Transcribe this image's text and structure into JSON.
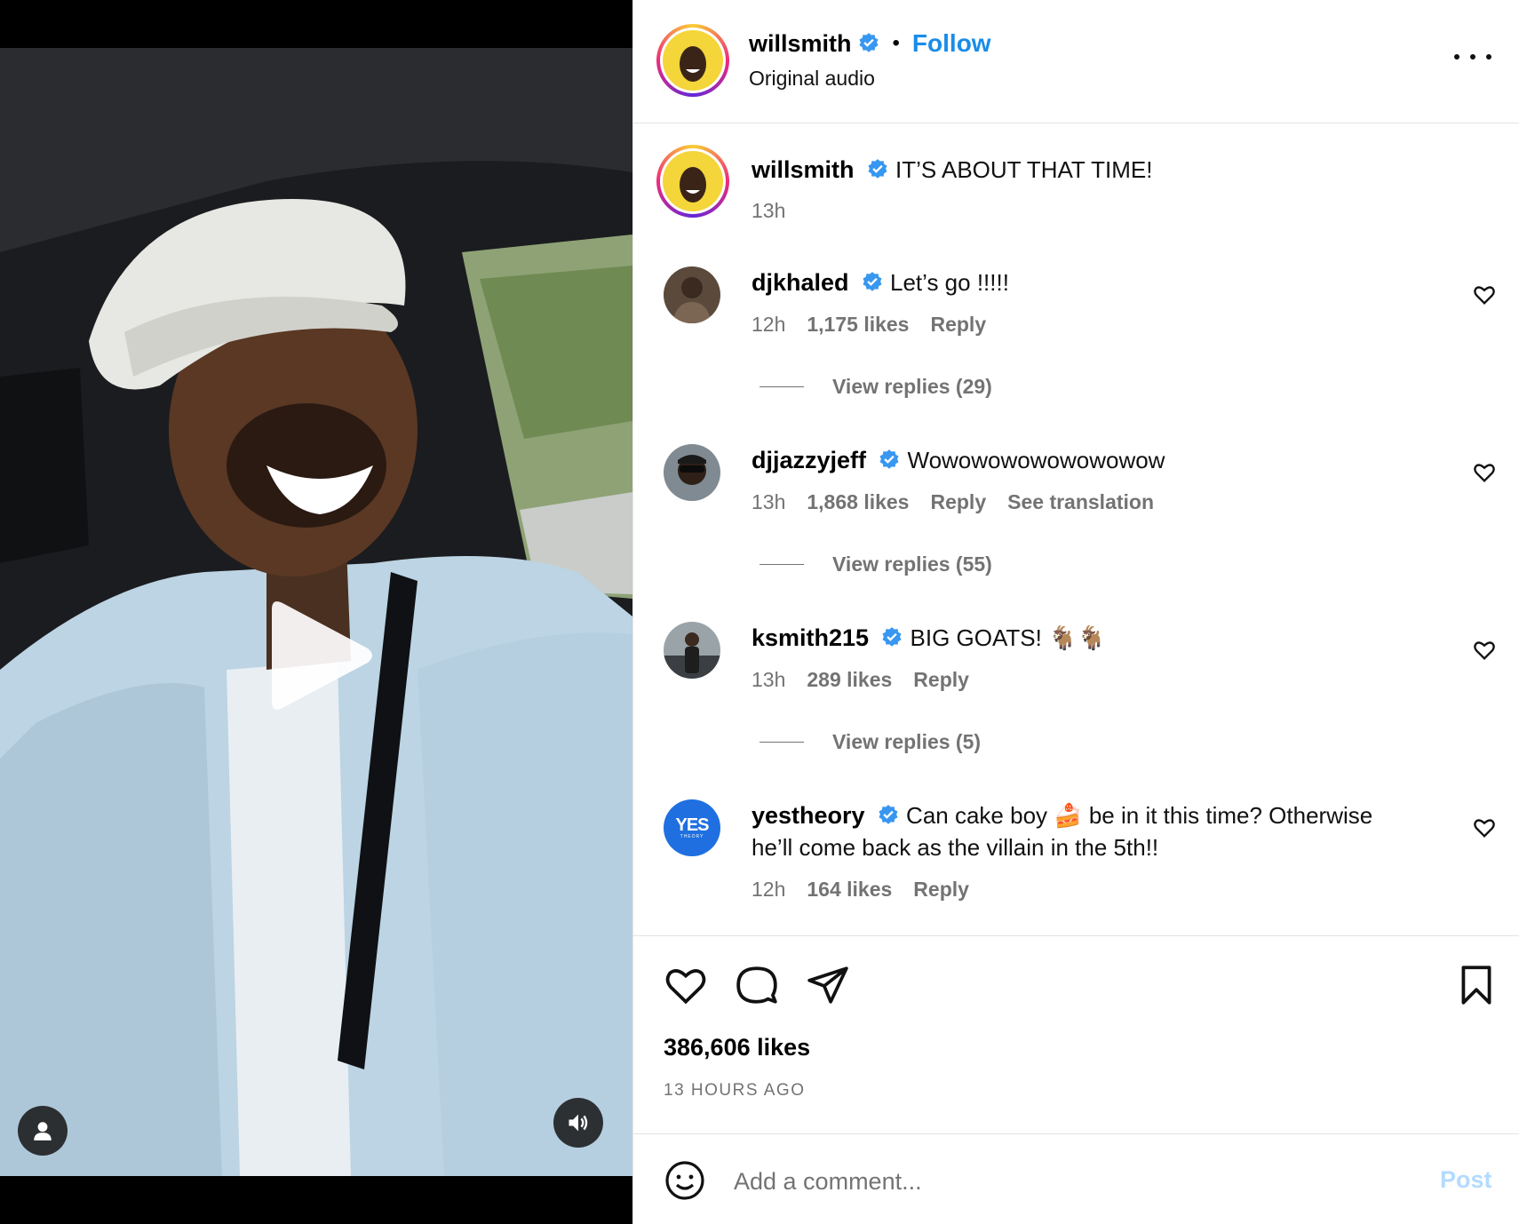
{
  "header": {
    "username": "willsmith",
    "separator": "•",
    "follow_label": "Follow",
    "subtitle": "Original audio"
  },
  "caption": {
    "username": "willsmith",
    "text": "IT’S ABOUT THAT TIME!",
    "time": "13h"
  },
  "comments": [
    {
      "username": "djkhaled",
      "text": "Let’s go !!!!!",
      "time": "12h",
      "likes": "1,175 likes",
      "reply_label": "Reply",
      "view_replies": "View replies (29)"
    },
    {
      "username": "djjazzyjeff",
      "text": "Wowowowowowowowow",
      "time": "13h",
      "likes": "1,868 likes",
      "reply_label": "Reply",
      "translation_label": "See translation",
      "view_replies": "View replies (55)"
    },
    {
      "username": "ksmith215",
      "text": "BIG GOATS! 🐐🐐",
      "time": "13h",
      "likes": "289 likes",
      "reply_label": "Reply",
      "view_replies": "View replies (5)"
    },
    {
      "username": "yestheory",
      "text": "Can cake boy 🍰 be in it this time? Otherwise he’ll come back as the villain in the 5th!!",
      "time": "12h",
      "likes": "164 likes",
      "reply_label": "Reply",
      "avatar_text": "YES",
      "avatar_subtext": "THEORY"
    }
  ],
  "post": {
    "likes": "386,606 likes",
    "time_ago": "13 HOURS AGO"
  },
  "composer": {
    "placeholder": "Add a comment...",
    "post_label": "Post"
  },
  "icons": {
    "like": "heart-icon",
    "comment": "comment-icon",
    "share": "paper-plane-icon",
    "save": "bookmark-icon",
    "more": "more-dots-icon",
    "emoji": "emoji-icon",
    "play": "play-icon",
    "account": "person-icon",
    "audio": "speaker-icon",
    "verified": "verified-badge-icon"
  },
  "colors": {
    "follow": "#1a8ce9",
    "verified": "#3897f0",
    "muted_text": "#737373",
    "post_disabled": "#b3dbff"
  }
}
